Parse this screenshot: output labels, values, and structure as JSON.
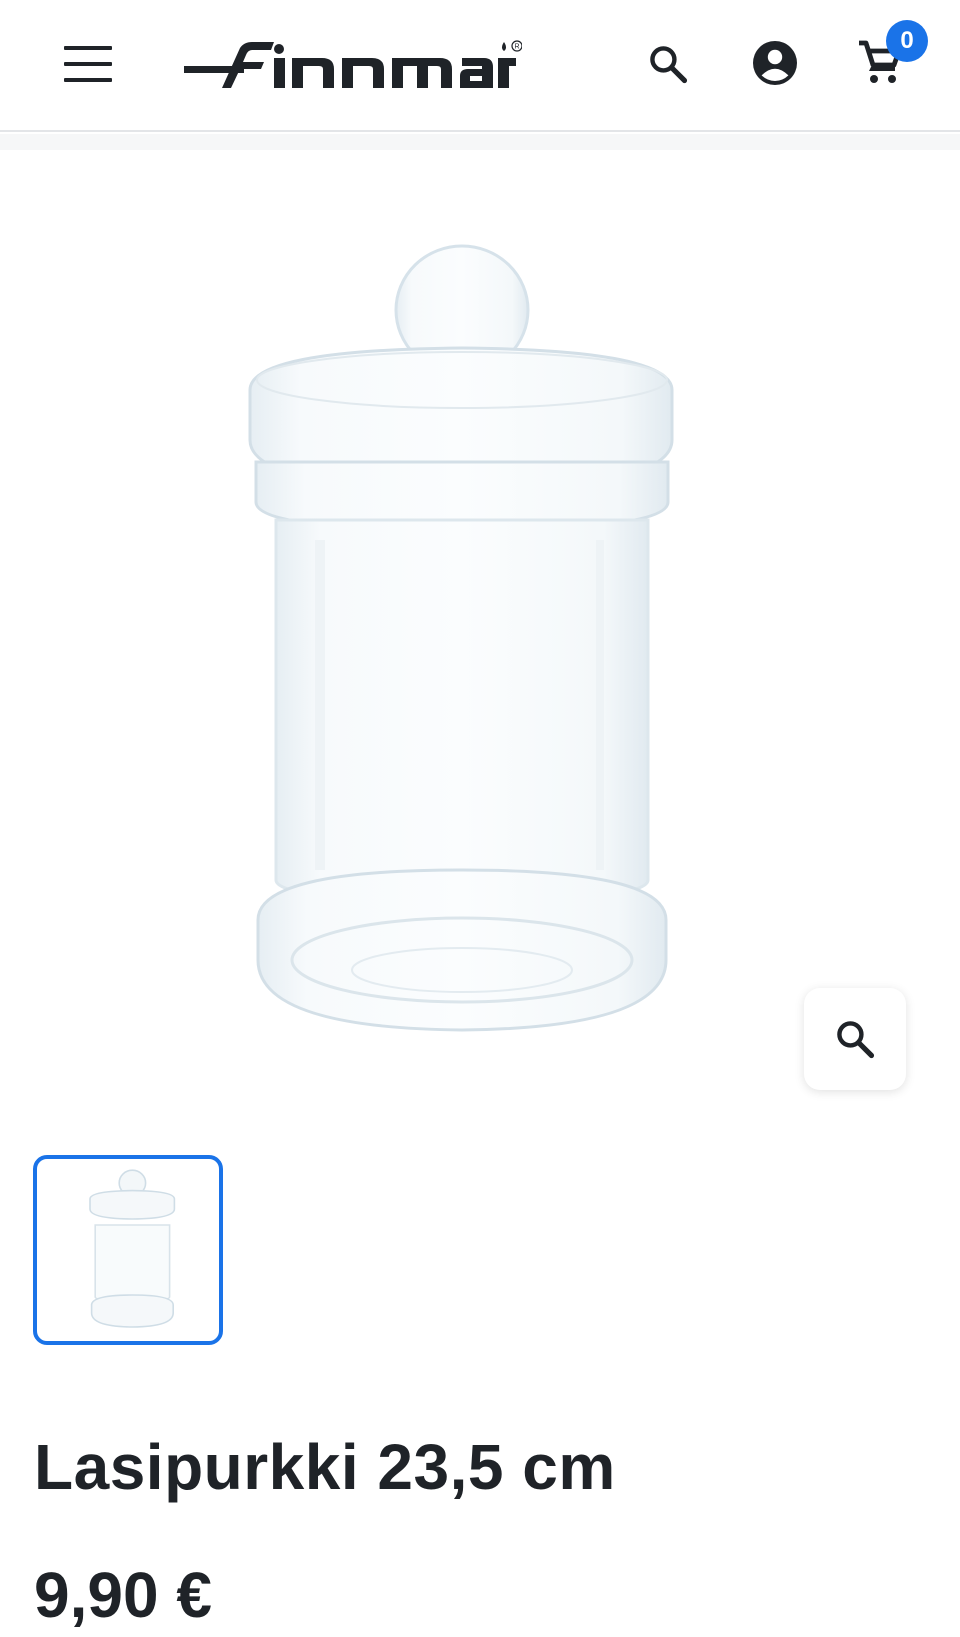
{
  "header": {
    "brand": "Finnmari",
    "cart_count": "0",
    "icons": [
      "menu-icon",
      "search-icon",
      "account-icon",
      "cart-icon"
    ]
  },
  "gallery": {
    "zoom_icon": "zoom-icon",
    "thumbnail_selected_index": 0
  },
  "product": {
    "title": "Lasipurkki 23,5 cm",
    "price": "9,90 €"
  },
  "colors": {
    "accent": "#1a73e8",
    "text": "#1f2328"
  }
}
